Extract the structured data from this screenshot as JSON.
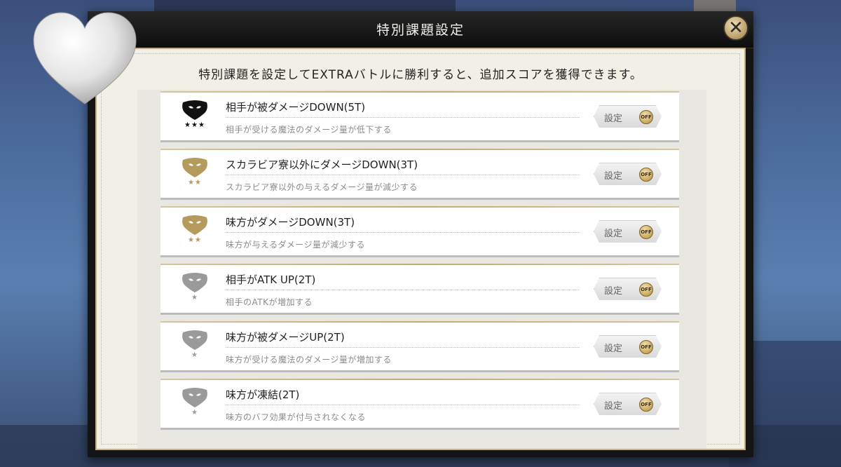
{
  "modal": {
    "title": "特別課題設定",
    "close_label": "✕",
    "intro": "特別課題を設定してEXTRAバトルに勝利すると、追加スコアを獲得できます。"
  },
  "tasks": [
    {
      "title": "相手が被ダメージDOWN(5T)",
      "desc": "相手が受ける魔法のダメージ量が低下する",
      "stars": "★★★",
      "mask_color": "#111111",
      "button_label": "設定",
      "toggle": "OFF"
    },
    {
      "title": "スカラビア寮以外にダメージDOWN(3T)",
      "desc": "スカラビア寮以外の与えるダメージ量が減少する",
      "stars": "★★",
      "mask_color": "#b59a5e",
      "button_label": "設定",
      "toggle": "OFF"
    },
    {
      "title": "味方がダメージDOWN(3T)",
      "desc": "味方が与えるダメージ量が減少する",
      "stars": "★★",
      "mask_color": "#b59a5e",
      "button_label": "設定",
      "toggle": "OFF"
    },
    {
      "title": "相手がATK UP(2T)",
      "desc": "相手のATKが増加する",
      "stars": "★",
      "mask_color": "#9a9a9a",
      "button_label": "設定",
      "toggle": "OFF"
    },
    {
      "title": "味方が被ダメージUP(2T)",
      "desc": "味方が受ける魔法のダメージ量が増加する",
      "stars": "★",
      "mask_color": "#9a9a9a",
      "button_label": "設定",
      "toggle": "OFF"
    },
    {
      "title": "味方が凍結(2T)",
      "desc": "味方のバフ効果が付与されなくなる",
      "stars": "★",
      "mask_color": "#9a9a9a",
      "button_label": "設定",
      "toggle": "OFF"
    }
  ]
}
